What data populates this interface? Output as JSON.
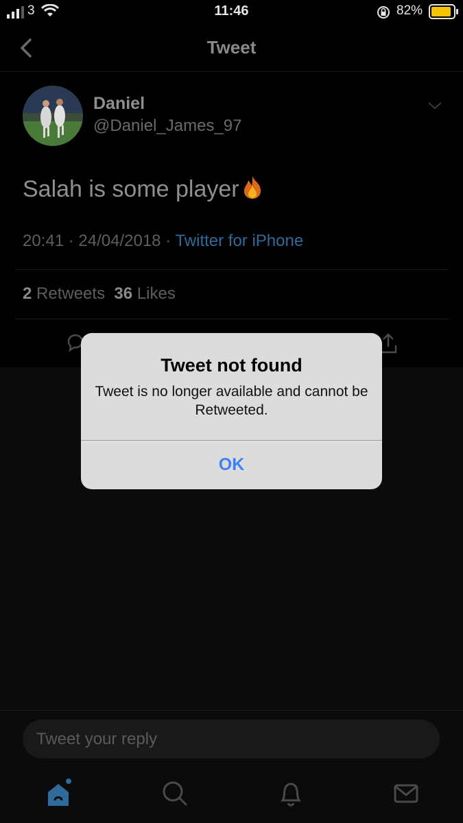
{
  "status_bar": {
    "carrier": "3",
    "time": "11:46",
    "battery": "82%"
  },
  "nav": {
    "title": "Tweet"
  },
  "tweet": {
    "name": "Daniel",
    "handle": "@Daniel_James_97",
    "text": "Salah is some player",
    "emoji": "fire-emoji",
    "time": "20:41",
    "date": "24/04/2018",
    "separator": "·",
    "source": "Twitter for iPhone",
    "retweets_count": "2",
    "retweets_label": "Retweets",
    "likes_count": "36",
    "likes_label": "Likes"
  },
  "alert": {
    "title": "Tweet not found",
    "message": "Tweet is no longer available and cannot be Retweeted.",
    "ok": "OK"
  },
  "reply": {
    "placeholder": "Tweet your reply"
  },
  "colors": {
    "background": "#000000",
    "accent_blue": "#3a82f6",
    "link_blue": "#2f6a9a",
    "alert_bg": "#dcdcdc"
  },
  "icons": [
    "signal-icon",
    "wifi-icon",
    "rotation-lock-icon",
    "battery-icon",
    "back-chevron-icon",
    "chevron-down-icon",
    "reply-icon",
    "share-icon",
    "home-icon",
    "search-icon",
    "notifications-icon",
    "messages-icon"
  ]
}
